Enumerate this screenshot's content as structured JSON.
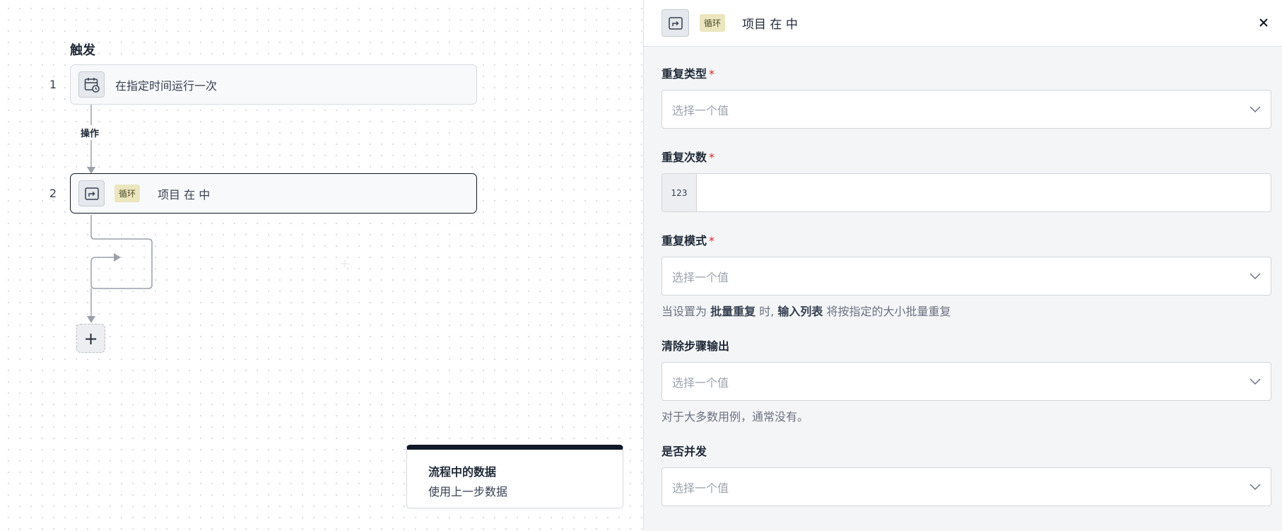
{
  "canvas": {
    "trigger_title": "触发",
    "op_label": "操作",
    "steps": [
      {
        "num": "1",
        "label": "在指定时间运行一次"
      },
      {
        "num": "2",
        "tag": "循环",
        "label": "项目 在 中"
      }
    ],
    "add_button": "+",
    "data_card": {
      "title": "流程中的数据",
      "subtitle": "使用上一步数据"
    }
  },
  "panel": {
    "header": {
      "tag": "循环",
      "title": "项目 在 中",
      "close": "×"
    },
    "fields": {
      "repeat_type": {
        "label": "重复类型",
        "required": "*",
        "placeholder": "选择一个值"
      },
      "repeat_count": {
        "label": "重复次数",
        "required": "*",
        "prefix": "123",
        "value": ""
      },
      "repeat_mode": {
        "label": "重复模式",
        "required": "*",
        "placeholder": "选择一个值",
        "hint_prefix": "当设置为 ",
        "hint_b1": "批量重复",
        "hint_mid": " 时, ",
        "hint_b2": "输入列表",
        "hint_suffix": " 将按指定的大小批量重复"
      },
      "clear_output": {
        "label": "清除步骤输出",
        "placeholder": "选择一个值",
        "hint": "对于大多数用例，通常没有。"
      },
      "concurrent": {
        "label": "是否并发",
        "placeholder": "选择一个值"
      }
    }
  }
}
